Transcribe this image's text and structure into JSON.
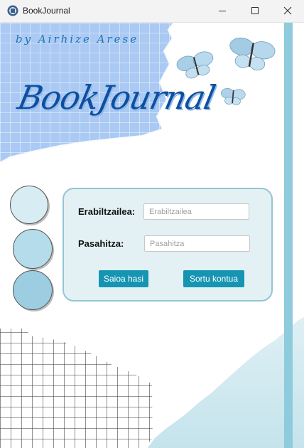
{
  "window": {
    "title": "BookJournal",
    "icon": "bookjournal-app-icon",
    "controls": [
      "minimize-icon",
      "maximize-icon",
      "close-icon"
    ]
  },
  "header": {
    "byline": "by Airhize Arese",
    "logo": "BookJournal"
  },
  "login": {
    "username_label": "Erabiltzailea:",
    "username_placeholder": "Erabiltzailea",
    "username_value": "",
    "password_label": "Pasahitza:",
    "password_placeholder": "Pasahitza",
    "password_value": "",
    "login_button": "Saioa hasi",
    "register_button": "Sortu kontua"
  },
  "colors": {
    "accent": "#1695b3",
    "panel_bg": "#e3f0f4",
    "panel_border": "#93c5d6",
    "logo_text": "#0d4fa0",
    "side_stripe": "#8ecbdc"
  }
}
